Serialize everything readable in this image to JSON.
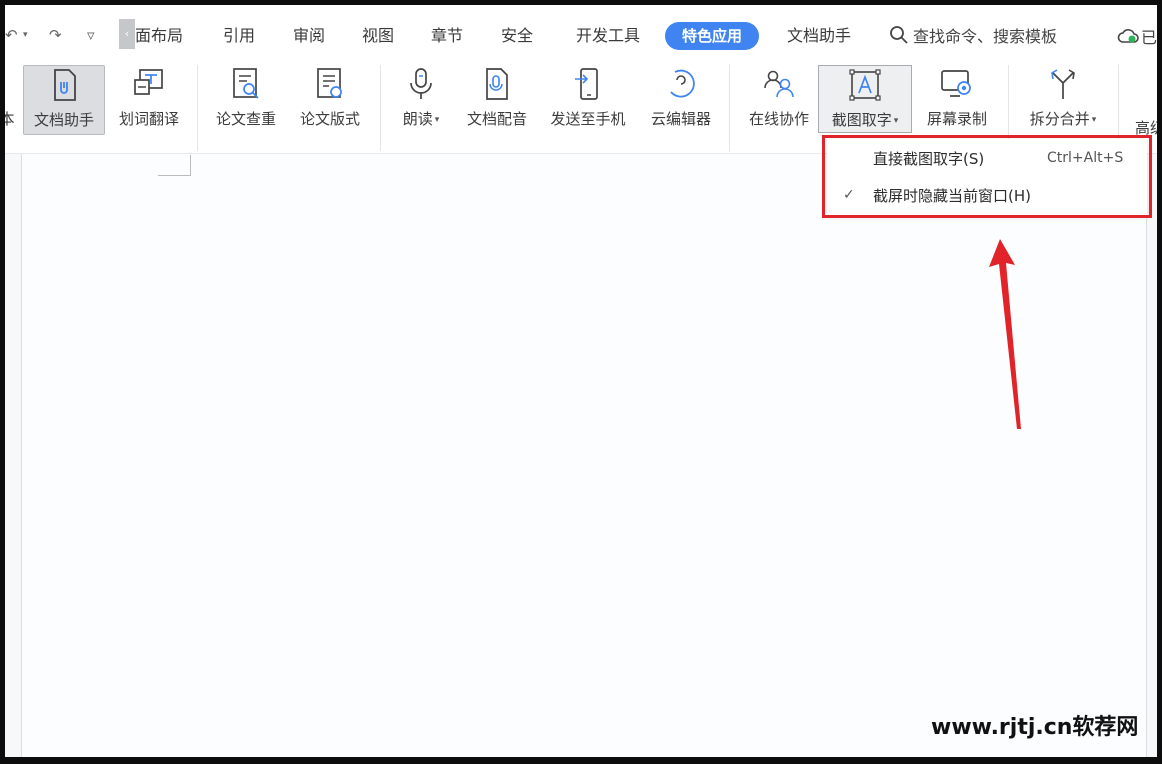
{
  "quick_access": {
    "undo": "↶",
    "redo": "↷",
    "more": "▿"
  },
  "menu": {
    "tabs": [
      "页面布局",
      "引用",
      "审阅",
      "视图",
      "章节",
      "安全",
      "开发工具",
      "特色应用",
      "文档助手"
    ],
    "search_placeholder": "查找命令、搜索模板",
    "sync_label": "已"
  },
  "ribbon": {
    "buttons": {
      "partial_left": "本",
      "doc_helper": "文档助手",
      "word_translate": "划词翻译",
      "paper_check": "论文查重",
      "paper_format": "论文版式",
      "read_aloud": "朗读",
      "doc_dubbing": "文档配音",
      "send_to_phone": "发送至手机",
      "cloud_review": "云编辑器",
      "online_collab": "在线协作",
      "screenshot_ocr": "截图取字",
      "screen_record": "屏幕录制",
      "split_merge": "拆分合并",
      "partial_right": "高级"
    }
  },
  "dropdown": {
    "items": [
      {
        "label": "直接截图取字(S)",
        "shortcut": "Ctrl+Alt+S",
        "checked": false
      },
      {
        "label": "截屏时隐藏当前窗口(H)",
        "shortcut": "",
        "checked": true
      }
    ],
    "check_glyph": "✓"
  },
  "annotation": {
    "color": "#e0242a"
  },
  "watermark": "www.rjtj.cn软荐网",
  "colors": {
    "accent": "#3f84f0",
    "highlight": "#e0242a"
  }
}
